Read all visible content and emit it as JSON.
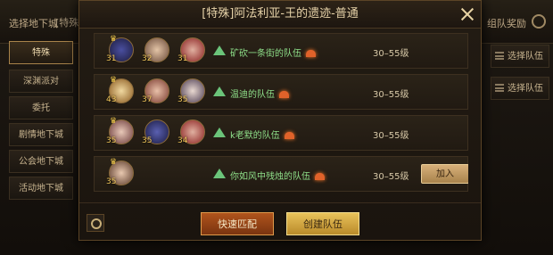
{
  "background": {
    "header_left": "选择地下城",
    "header_tag": "[特殊]",
    "header_right": "组队奖励",
    "sidebar": [
      "特殊",
      "深渊派对",
      "委托",
      "剧情地下城",
      "公会地下城",
      "活动地下城"
    ],
    "right_buttons": [
      "选择队伍",
      "选择队伍"
    ]
  },
  "modal": {
    "title": "[特殊]阿法利亚-王的遗迹-普通",
    "rows": [
      {
        "members": [
          {
            "level": "31",
            "leader": true
          },
          {
            "level": "32",
            "leader": false
          },
          {
            "level": "31",
            "leader": false
          }
        ],
        "team_name": "矿砍一条街的队伍",
        "range": "30–55级",
        "action": ""
      },
      {
        "members": [
          {
            "level": "43",
            "leader": true
          },
          {
            "level": "37",
            "leader": false
          },
          {
            "level": "35",
            "leader": false
          }
        ],
        "team_name": "温迪的队伍",
        "range": "30–55级",
        "action": ""
      },
      {
        "members": [
          {
            "level": "35",
            "leader": true
          },
          {
            "level": "35",
            "leader": false
          },
          {
            "level": "34",
            "leader": false
          }
        ],
        "team_name": "k老默的队伍",
        "range": "30–55级",
        "action": ""
      },
      {
        "members": [
          {
            "level": "35",
            "leader": true
          }
        ],
        "team_name": "你如风中残烛的队伍",
        "range": "30–55级",
        "action": "加入"
      }
    ],
    "quick_match": "快速匹配",
    "create_team": "创建队伍"
  },
  "colors": {
    "accent_gold": "#e8c25a",
    "accent_orange": "#b0541c",
    "team_green": "#8fe08a",
    "level_yellow": "#f0c65a"
  }
}
